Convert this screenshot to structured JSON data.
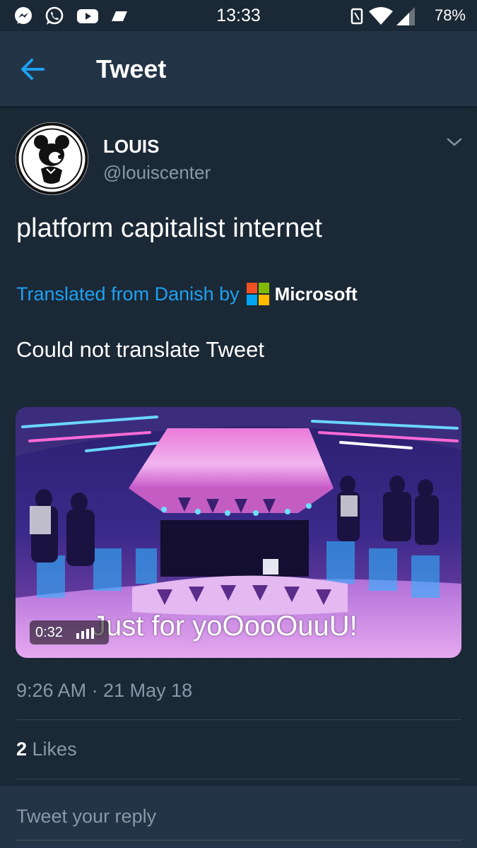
{
  "status_bar": {
    "time": "13:33",
    "battery": "78%",
    "left_icons": [
      "messenger-icon",
      "whatsapp-icon",
      "youtube-icon",
      "tag-icon"
    ],
    "right_icons": [
      "vibrate-icon",
      "wifi-icon",
      "signal-icon"
    ]
  },
  "header": {
    "title": "Tweet",
    "back_icon": "arrow-left-icon"
  },
  "tweet": {
    "author_name": "LOUIS",
    "author_handle": "@louiscenter",
    "text": "platform capitalist internet",
    "translated_label": "Translated from Danish by",
    "translator": "Microsoft",
    "translate_status": "Could not translate Tweet",
    "video": {
      "duration": "0:32",
      "caption": "Just for yoOooOuuU!"
    },
    "timestamp": "9:26 AM · 21 May 18",
    "likes_count": "2",
    "likes_label": " Likes"
  },
  "reply": {
    "placeholder": "Tweet your reply"
  },
  "colors": {
    "background": "#1b2836",
    "header": "#243447",
    "accent": "#1da1f2",
    "muted": "#8899a6",
    "divider": "#38444d"
  }
}
